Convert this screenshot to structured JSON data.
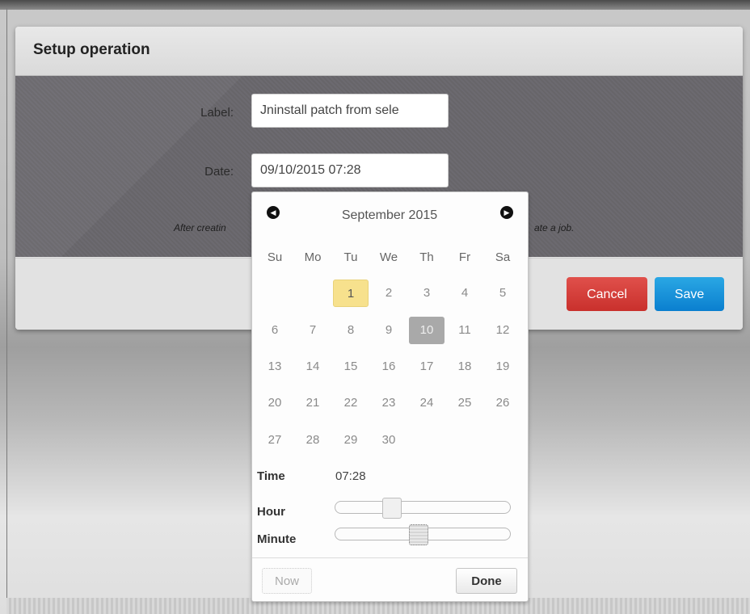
{
  "dialog": {
    "title": "Setup operation",
    "label_field": {
      "label": "Label:",
      "value": "Jninstall patch from sele"
    },
    "date_field": {
      "label": "Date:",
      "value": "09/10/2015 07:28"
    },
    "note_left": "After creatin",
    "note_right": "ate a job.",
    "cancel_label": "Cancel",
    "save_label": "Save",
    "colors": {
      "cancel": "#d9534f",
      "save": "#1a8fd8"
    }
  },
  "datepicker": {
    "month_title": "September 2015",
    "prev_icon": "chevron-left-icon",
    "next_icon": "chevron-right-icon",
    "weekdays": [
      "Su",
      "Mo",
      "Tu",
      "We",
      "Th",
      "Fr",
      "Sa"
    ],
    "weeks": [
      [
        "",
        "",
        "1",
        "2",
        "3",
        "4",
        "5"
      ],
      [
        "6",
        "7",
        "8",
        "9",
        "10",
        "11",
        "12"
      ],
      [
        "13",
        "14",
        "15",
        "16",
        "17",
        "18",
        "19"
      ],
      [
        "20",
        "21",
        "22",
        "23",
        "24",
        "25",
        "26"
      ],
      [
        "27",
        "28",
        "29",
        "30",
        "",
        "",
        ""
      ]
    ],
    "today": "1",
    "selected": "10",
    "time_label": "Time",
    "time_value": "07:28",
    "hour_label": "Hour",
    "minute_label": "Minute",
    "hour_level": 0.3,
    "minute_level": 0.47,
    "now_label": "Now",
    "done_label": "Done",
    "colors": {
      "today": "#f7e18d",
      "selected": "#a9a9a9"
    }
  }
}
